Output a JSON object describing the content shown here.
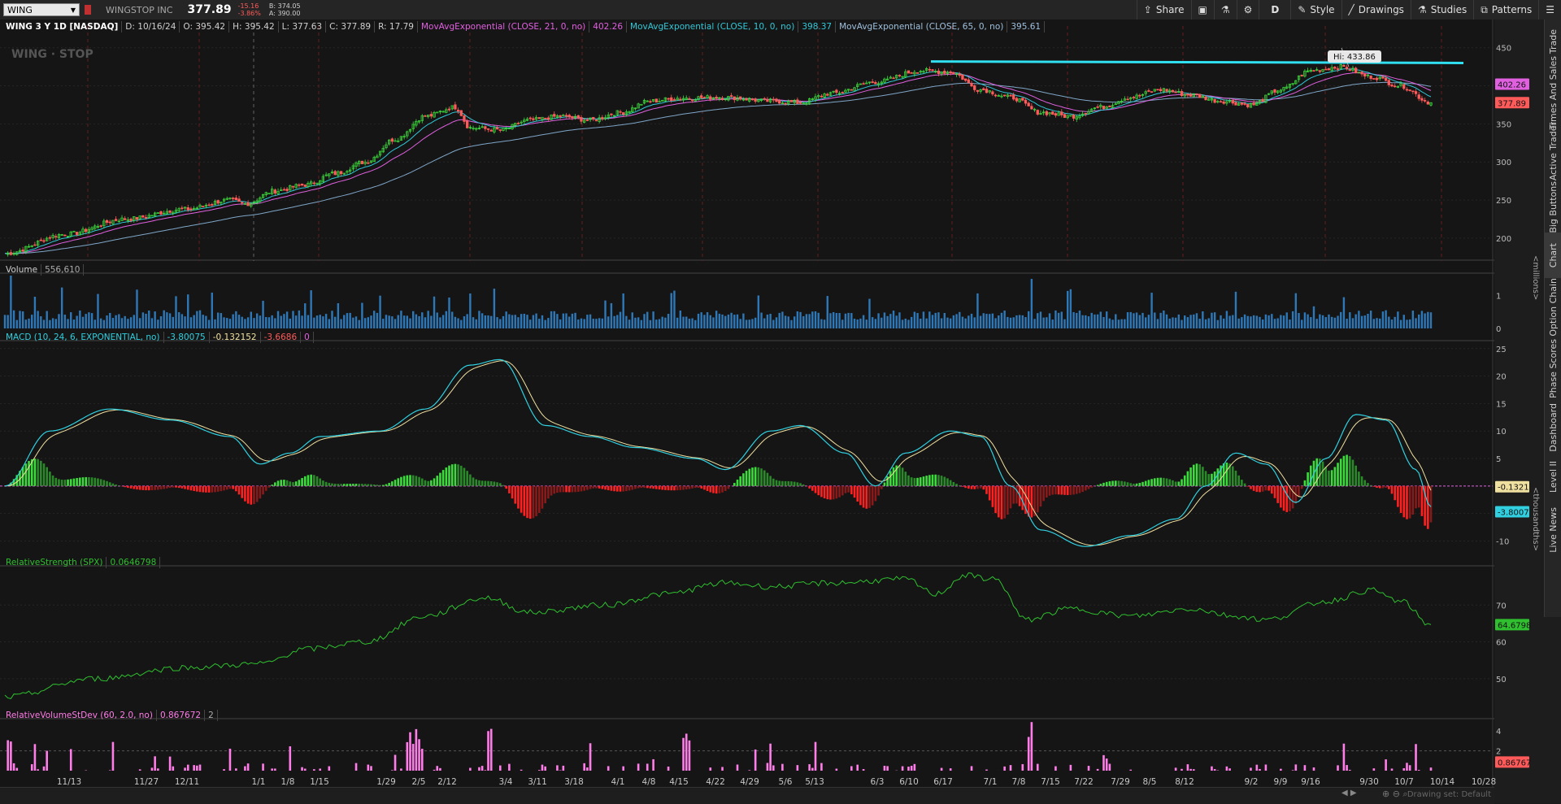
{
  "toolbar": {
    "symbol": "WING",
    "company": "WINGSTOP INC",
    "last": "377.89",
    "change": "-15.16",
    "change_pct": "-3.86%",
    "bid": "B: 374.05",
    "ask": "A: 390.00",
    "share_label": "Share",
    "aggregation_label": "D",
    "style_label": "Style",
    "drawings_label": "Drawings",
    "studies_label": "Studies",
    "patterns_label": "Patterns"
  },
  "header": {
    "title": "WING 3 Y 1D [NASDAQ]",
    "date": "D: 10/16/24",
    "open": "O: 395.42",
    "high": "H: 395.42",
    "low": "L: 377.63",
    "close": "C: 377.89",
    "range": "R: 17.79",
    "ema21_label": "MovAvgExponential (CLOSE, 21, 0, no)",
    "ema21_value": "402.26",
    "ema10_label": "MovAvgExponential (CLOSE, 10, 0, no)",
    "ema10_value": "398.37",
    "ema65_label": "MovAvgExponential (CLOSE, 65, 0, no)",
    "ema65_value": "395.61",
    "watermark": "WING · STOP",
    "hi_bubble": "Hi: 433.86",
    "price_badge_ema": "402.26",
    "price_badge_last": "377.89"
  },
  "volume": {
    "label": "Volume",
    "value": "556,610",
    "axis_unit": "<millions>"
  },
  "macd": {
    "label": "MACD (10, 24, 6, EXPONENTIAL, no)",
    "value": "-3.80075",
    "avg": "-0.132152",
    "diff": "-3.6686",
    "zero": "0",
    "badge_avg": "-0.1321",
    "badge_value": "-3.8007"
  },
  "rs": {
    "label": "RelativeStrength (SPX)",
    "value": "0.0646798",
    "axis_unit": "<thousandths>",
    "badge": "64.6798"
  },
  "rvol": {
    "label": "RelativeVolumeStDev (60, 2.0, no)",
    "value": "0.867672",
    "level": "2",
    "badge": "0.86767"
  },
  "side_tabs": [
    "Trade",
    "Times And Sales",
    "Active Trader",
    "Big Buttons",
    "Chart",
    "Option Chain",
    "Phase Scores",
    "Dashboard",
    "Level II",
    "Live News"
  ],
  "status": {
    "drawing_set": "Drawing set: Default"
  },
  "colors": {
    "up": "#3ddc3d",
    "down": "#ff5a5a",
    "ema21": "#e060e0",
    "ema10": "#30c8d8",
    "ema65": "#7fa6c8",
    "macd": "#30d0e0",
    "macd_avg": "#f0e0a0",
    "volume": "#2e78b8",
    "rs": "#2fbf2f",
    "rvol": "#ff7de8",
    "trendline": "#30e0f0"
  },
  "chart_data": [
    {
      "type": "candlestick",
      "title": "WING 3 Y 1D [NASDAQ]",
      "x_ticks": [
        "11/13",
        "11/27",
        "12/11",
        "1/1",
        "1/8",
        "1/15",
        "1/29",
        "2/5",
        "2/12",
        "3/4",
        "3/11",
        "3/18",
        "4/1",
        "4/8",
        "4/15",
        "4/22",
        "4/29",
        "5/6",
        "5/13",
        "6/3",
        "6/10",
        "6/17",
        "7/1",
        "7/8",
        "7/15",
        "7/22",
        "7/29",
        "8/5",
        "8/12",
        "9/2",
        "9/9",
        "9/16",
        "9/30",
        "10/7",
        "10/14",
        "10/28"
      ],
      "y_ticks": [
        200,
        250,
        300,
        350,
        400,
        450
      ],
      "ylim": [
        170,
        470
      ],
      "series": [
        {
          "name": "Close",
          "anchors": [
            [
              0,
              180
            ],
            [
              20,
              205
            ],
            [
              40,
              225
            ],
            [
              60,
              238
            ],
            [
              75,
              250
            ],
            [
              80,
              245
            ],
            [
              90,
              262
            ],
            [
              100,
              270
            ],
            [
              110,
              285
            ],
            [
              120,
              300
            ],
            [
              130,
              330
            ],
            [
              140,
              360
            ],
            [
              150,
              372
            ],
            [
              155,
              345
            ],
            [
              165,
              342
            ],
            [
              175,
              355
            ],
            [
              185,
              360
            ],
            [
              195,
              355
            ],
            [
              205,
              365
            ],
            [
              215,
              380
            ],
            [
              225,
              384
            ],
            [
              240,
              385
            ],
            [
              255,
              380
            ],
            [
              265,
              378
            ],
            [
              275,
              390
            ],
            [
              290,
              405
            ],
            [
              305,
              420
            ],
            [
              315,
              418
            ],
            [
              325,
              395
            ],
            [
              335,
              385
            ],
            [
              345,
              365
            ],
            [
              355,
              360
            ],
            [
              365,
              372
            ],
            [
              375,
              385
            ],
            [
              385,
              395
            ],
            [
              395,
              388
            ],
            [
              405,
              380
            ],
            [
              415,
              375
            ],
            [
              425,
              395
            ],
            [
              435,
              420
            ],
            [
              445,
              425
            ],
            [
              455,
              412
            ],
            [
              465,
              400
            ],
            [
              475,
              377.89
            ]
          ]
        },
        {
          "name": "MovAvgExponential (CLOSE, 21, 0, no)",
          "last": 402.26
        },
        {
          "name": "MovAvgExponential (CLOSE, 10, 0, no)",
          "last": 398.37
        },
        {
          "name": "MovAvgExponential (CLOSE, 65, 0, no)",
          "last": 395.61
        }
      ],
      "high_marker": 433.86
    },
    {
      "type": "bar",
      "title": "Volume",
      "ylabel": "<millions>",
      "y_ticks": [
        0,
        1
      ],
      "ylim": [
        0,
        1.6
      ],
      "last": 556610
    },
    {
      "type": "line",
      "title": "MACD (10, 24, 6, EXPONENTIAL, no)",
      "y_ticks": [
        -10,
        -5,
        0,
        5,
        10,
        15,
        20,
        25
      ],
      "ylim": [
        -12,
        26
      ],
      "anchors": [
        [
          0,
          0
        ],
        [
          15,
          10
        ],
        [
          35,
          14
        ],
        [
          55,
          12
        ],
        [
          75,
          9
        ],
        [
          85,
          4
        ],
        [
          95,
          6
        ],
        [
          105,
          9
        ],
        [
          125,
          10
        ],
        [
          140,
          14
        ],
        [
          155,
          22
        ],
        [
          165,
          23
        ],
        [
          180,
          11
        ],
        [
          195,
          9
        ],
        [
          210,
          7
        ],
        [
          230,
          5
        ],
        [
          240,
          3
        ],
        [
          255,
          10
        ],
        [
          265,
          11
        ],
        [
          280,
          6
        ],
        [
          290,
          0
        ],
        [
          300,
          6
        ],
        [
          315,
          10
        ],
        [
          325,
          9
        ],
        [
          335,
          0
        ],
        [
          345,
          -8
        ],
        [
          360,
          -11
        ],
        [
          375,
          -9
        ],
        [
          390,
          -6
        ],
        [
          400,
          0
        ],
        [
          410,
          6
        ],
        [
          420,
          4
        ],
        [
          430,
          -3
        ],
        [
          440,
          5
        ],
        [
          450,
          13
        ],
        [
          460,
          12
        ],
        [
          470,
          3
        ],
        [
          475,
          -3.8
        ]
      ],
      "last_macd": -3.80075,
      "last_avg": -0.132152,
      "last_diff": -3.6686
    },
    {
      "type": "line",
      "title": "RelativeStrength (SPX)",
      "ylabel": "<thousandths>",
      "y_ticks": [
        50,
        60,
        70
      ],
      "ylim": [
        44,
        80
      ],
      "anchors": [
        [
          0,
          45
        ],
        [
          30,
          50
        ],
        [
          60,
          53
        ],
        [
          85,
          54
        ],
        [
          100,
          58
        ],
        [
          120,
          60
        ],
        [
          140,
          67
        ],
        [
          160,
          72
        ],
        [
          175,
          68
        ],
        [
          200,
          70
        ],
        [
          220,
          73
        ],
        [
          240,
          76
        ],
        [
          255,
          75
        ],
        [
          275,
          76
        ],
        [
          300,
          77
        ],
        [
          310,
          73
        ],
        [
          320,
          78
        ],
        [
          330,
          77
        ],
        [
          340,
          66
        ],
        [
          355,
          69
        ],
        [
          375,
          67
        ],
        [
          395,
          69
        ],
        [
          410,
          67
        ],
        [
          420,
          66
        ],
        [
          440,
          71
        ],
        [
          455,
          74
        ],
        [
          465,
          71
        ],
        [
          475,
          64.68
        ]
      ],
      "last": 64.6798
    },
    {
      "type": "bar",
      "title": "RelativeVolumeStDev (60, 2.0, no)",
      "y_ticks": [
        2,
        4
      ],
      "ylim": [
        0,
        5
      ],
      "threshold": 2,
      "last": 0.867672
    }
  ]
}
